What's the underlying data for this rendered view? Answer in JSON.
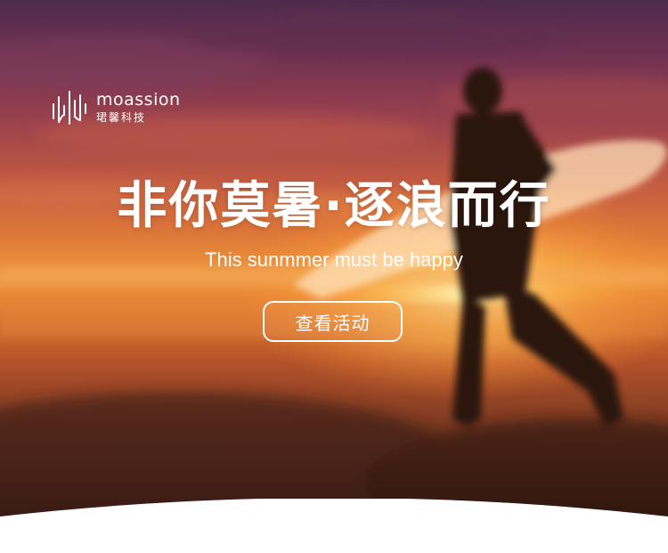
{
  "brand": {
    "name_en": "moassion",
    "name_cn": "珺馨科技"
  },
  "hero": {
    "headline": "非你莫暑·逐浪而行",
    "subline": "This sunmmer must be happy",
    "cta_label": "查看活动"
  },
  "colors": {
    "text": "#ffffff",
    "sky_top": "#4d2b4d",
    "sunset_glow": "#f09a3e",
    "sand_dark": "#2a1510",
    "surfer_silhouette": "#2b1410"
  },
  "icons": [
    "moassion-logo-icon"
  ]
}
